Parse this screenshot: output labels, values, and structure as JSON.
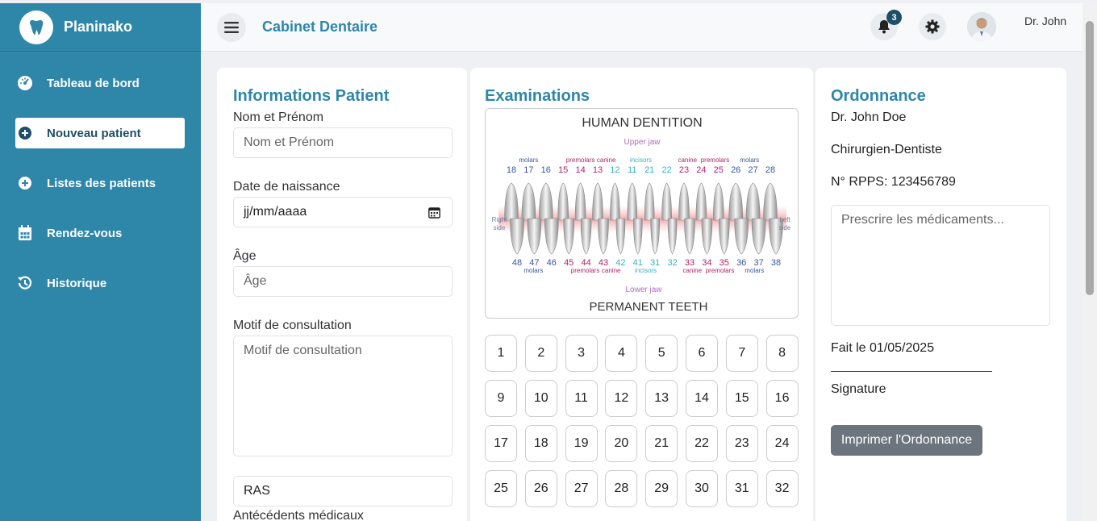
{
  "brand": {
    "name": "Planinako",
    "logo_icon": "tooth-icon"
  },
  "sidebar": {
    "items": [
      {
        "label": "Tableau de bord",
        "icon": "dashboard-icon",
        "active": false
      },
      {
        "label": "Nouveau patient",
        "icon": "plus-circle-icon",
        "active": true
      },
      {
        "label": "Listes des patients",
        "icon": "plus-circle-icon",
        "active": false
      },
      {
        "label": "Rendez-vous",
        "icon": "calendar-icon",
        "active": false
      },
      {
        "label": "Historique",
        "icon": "history-icon",
        "active": false
      }
    ]
  },
  "header": {
    "title": "Cabinet Dentaire",
    "notification_count": "3",
    "user_name": "Dr. John"
  },
  "patient_info": {
    "title": "Informations Patient",
    "name_label": "Nom et Prénom",
    "name_placeholder": "Nom et Prénom",
    "dob_label": "Date de naissance",
    "dob_placeholder": "jj/mm/aaaa",
    "age_label": "Âge",
    "age_placeholder": "Âge",
    "motif_label": "Motif de consultation",
    "motif_placeholder": "Motif de consultation",
    "antecedents_value": "RAS",
    "antecedents_label": "Antécédents médicaux"
  },
  "examinations": {
    "title": "Examinations",
    "chart": {
      "title": "HUMAN  DENTITION",
      "upper_jaw": "Upper jaw",
      "lower_jaw": "Lower jaw",
      "bottom_title": "PERMANENT TEETH",
      "right_side": "Right side",
      "left_side": "Left side",
      "upper_numbers": [
        "18",
        "17",
        "16",
        "15",
        "14",
        "13",
        "12",
        "11",
        "21",
        "22",
        "23",
        "24",
        "25",
        "26",
        "27",
        "28"
      ],
      "lower_numbers": [
        "48",
        "47",
        "46",
        "45",
        "44",
        "43",
        "42",
        "41",
        "31",
        "32",
        "33",
        "34",
        "35",
        "36",
        "37",
        "38"
      ],
      "group_labels": [
        "molars",
        "premolars",
        "canine",
        "incisors",
        "canine",
        "premolars",
        "molars"
      ]
    },
    "teeth": [
      "1",
      "2",
      "3",
      "4",
      "5",
      "6",
      "7",
      "8",
      "9",
      "10",
      "11",
      "12",
      "13",
      "14",
      "15",
      "16",
      "17",
      "18",
      "19",
      "20",
      "21",
      "22",
      "23",
      "24",
      "25",
      "26",
      "27",
      "28",
      "29",
      "30",
      "31",
      "32"
    ]
  },
  "ordonnance": {
    "title": "Ordonnance",
    "doctor": "Dr. John Doe",
    "specialty": "Chirurgien-Dentiste",
    "rpps": "N° RPPS: 123456789",
    "prescription_placeholder": "Prescrire les médicaments...",
    "date_text": "Fait le 01/05/2025",
    "signature_label": "Signature",
    "print_button": "Imprimer l'Ordonnance"
  },
  "colors": {
    "primary": "#2e86a9",
    "dark": "#1f4f66",
    "button_gray": "#6c757d"
  }
}
